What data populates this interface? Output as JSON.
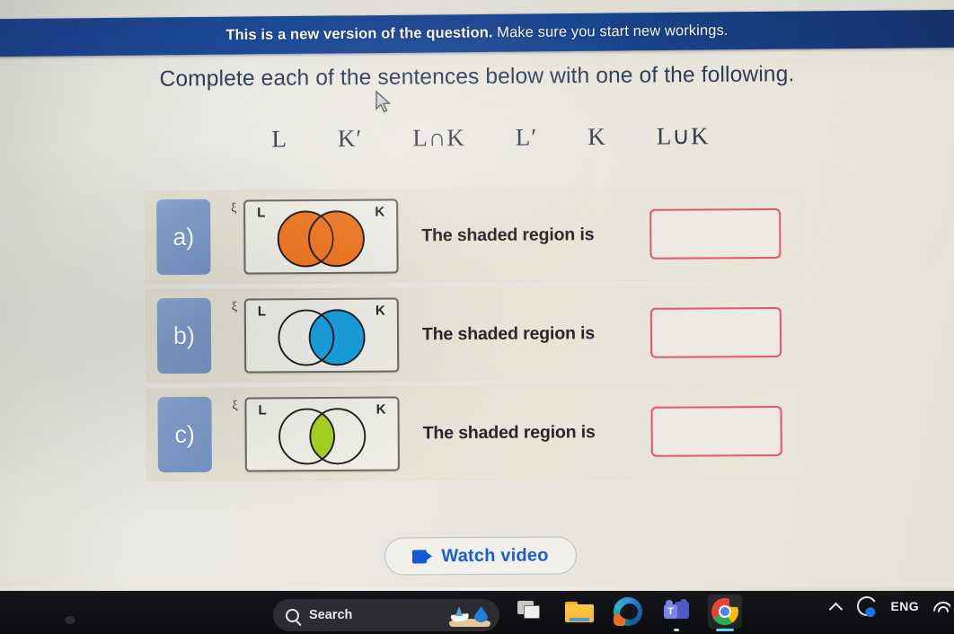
{
  "banner": {
    "bold_text": "This is a new version of the question.",
    "normal_text": " Make sure you start new workings."
  },
  "prompt": "Complete each of the sentences below with one of the following.",
  "options": [
    {
      "label": "L"
    },
    {
      "label": "K′"
    },
    {
      "label": "L∩K"
    },
    {
      "label": "L′"
    },
    {
      "label": "K"
    },
    {
      "label": "L∪K"
    }
  ],
  "questions": [
    {
      "badge": "a)",
      "universe_symbol": "ξ",
      "left_label": "L",
      "right_label": "K",
      "sentence": "The shaded region is",
      "answer_value": "",
      "shading": "union",
      "shade_color": "#F07823"
    },
    {
      "badge": "b)",
      "universe_symbol": "ξ",
      "left_label": "L",
      "right_label": "K",
      "sentence": "The shaded region is",
      "answer_value": "",
      "shading": "right-set",
      "shade_color": "#1CA0E0"
    },
    {
      "badge": "c)",
      "universe_symbol": "ξ",
      "left_label": "L",
      "right_label": "K",
      "sentence": "The shaded region is",
      "answer_value": "",
      "shading": "intersection",
      "shade_color": "#A5D221"
    }
  ],
  "watch_video": {
    "label": "Watch video",
    "icon": "video-camera-icon"
  },
  "taskbar": {
    "start_icon": "windows-start-icon",
    "search_placeholder": "Search",
    "search_icon": "search-icon",
    "apps": [
      {
        "name": "task-view",
        "label": "Task View"
      },
      {
        "name": "file-explorer",
        "label": "File Explorer"
      },
      {
        "name": "microsoft-edge",
        "label": "Microsoft Edge"
      },
      {
        "name": "microsoft-teams",
        "label": "Microsoft Teams"
      },
      {
        "name": "google-chrome",
        "label": "Google Chrome"
      }
    ],
    "tray": {
      "chevron": "chevron-up-icon",
      "sync": "sync-icon",
      "language": "ENG",
      "wifi": "wifi-icon"
    }
  },
  "colors": {
    "banner_blue": "#1b4693",
    "badge_blue": "#7e9bc8",
    "answer_border_red": "#e4566a",
    "link_blue": "#1a5fd0",
    "panel_beige": "#e7e4d6"
  }
}
